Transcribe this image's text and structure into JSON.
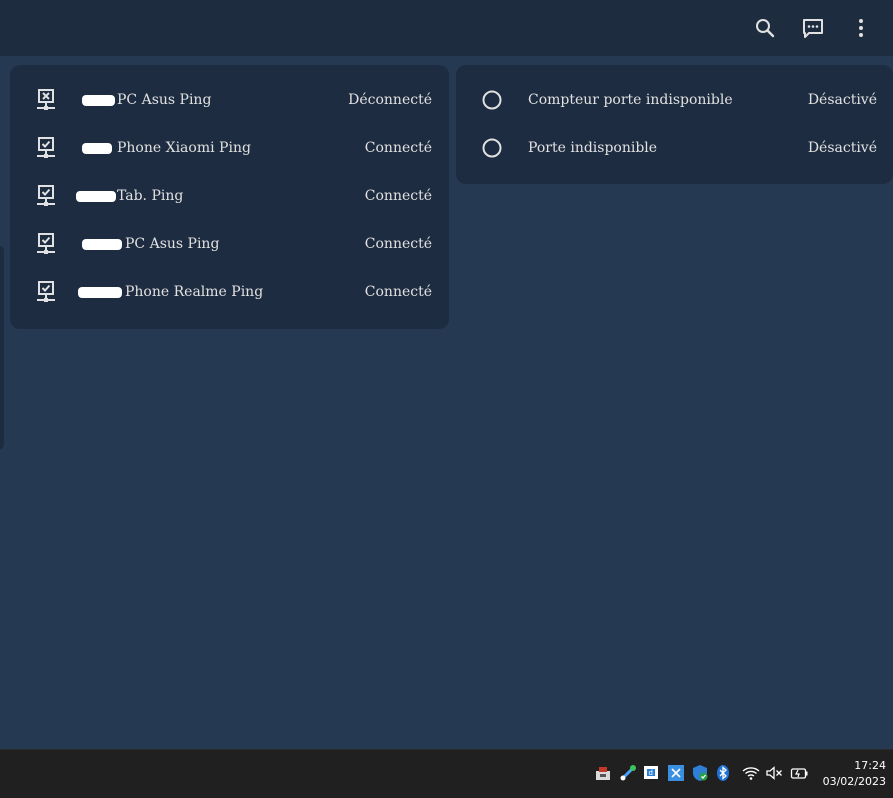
{
  "header": {
    "icons": [
      "search-icon",
      "assist-icon",
      "menu-dots-icon"
    ]
  },
  "devices": [
    {
      "name": "PC Asus Ping",
      "state": "Déconnecté",
      "icon": "lan-disconnect-icon"
    },
    {
      "name": "Phone Xiaomi Ping",
      "state": "Connecté",
      "icon": "lan-connect-icon"
    },
    {
      "name": "Tab. Ping",
      "state": "Connecté",
      "icon": "lan-connect-icon"
    },
    {
      "name": "PC Asus Ping",
      "state": "Connecté",
      "icon": "lan-connect-icon"
    },
    {
      "name": "Phone Realme Ping",
      "state": "Connecté",
      "icon": "lan-connect-icon"
    }
  ],
  "doors": [
    {
      "name": "Compteur porte indisponible",
      "state": "Désactivé",
      "icon": "circle-outline-icon"
    },
    {
      "name": "Porte indisponible",
      "state": "Désactivé",
      "icon": "circle-outline-icon"
    }
  ],
  "taskbar": {
    "time": "17:24",
    "date": "03/02/2023",
    "tray_icons": [
      "usb-eject-icon",
      "network-tool-icon",
      "display-icon",
      "snipping-icon",
      "defender-icon",
      "bluetooth-icon",
      "wifi-icon",
      "volume-muted-icon",
      "battery-charging-icon"
    ]
  },
  "colors": {
    "background": "#253a52",
    "card": "#1d2c40",
    "topbar": "#1e2c40",
    "taskbar": "#202020"
  }
}
